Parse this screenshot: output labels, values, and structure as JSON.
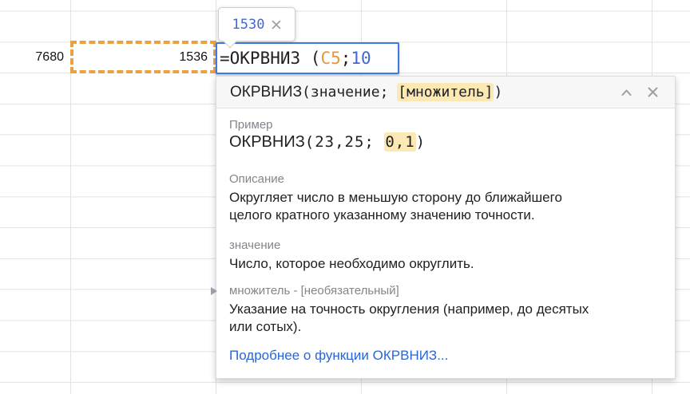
{
  "colors": {
    "editing_border_blue": "#3d7ae8",
    "referenced_cell_orange": "#eda03f",
    "token_ref_orange": "#e8953b",
    "token_number_blue": "#3f66d2",
    "tooltip_value_blue": "#4467cd",
    "highlight_yellow": "#fce8b2",
    "link_blue": "#2767d5",
    "label_gray": "#80868b",
    "grid_line": "#e2e2e2"
  },
  "cells": {
    "left_value": "7680",
    "ref_value": "1536"
  },
  "formula": {
    "tokens": [
      {
        "text": "=ОКРВНИЗ (",
        "type": "text"
      },
      {
        "text": "C5",
        "type": "cell-ref"
      },
      {
        "text": ";",
        "type": "text"
      },
      {
        "text": "10",
        "type": "number"
      }
    ]
  },
  "value_tooltip": {
    "value": "1530"
  },
  "help_popup": {
    "signature": {
      "name": "ОКРВНИЗ",
      "args_pre": "(значение; ",
      "optional_arg": "[множитель]",
      "args_post": ")"
    },
    "example": {
      "label": "Пример",
      "name": "ОКРВНИЗ",
      "args_pre": "(23,25; ",
      "highlight": "0,1",
      "args_post": ")"
    },
    "description": {
      "label": "Описание",
      "text": "Округляет число в меньшую сторону до ближайшего\nцелого кратного указанному значению точности."
    },
    "arg_value": {
      "label": "значение",
      "text": "Число, которое необходимо округлить."
    },
    "arg_multiplier": {
      "label": "множитель - [необязательный]",
      "text": "Указание на точность округления (например, до десятых\nили сотых)."
    },
    "link": "Подробнее о функции ОКРВНИЗ..."
  }
}
